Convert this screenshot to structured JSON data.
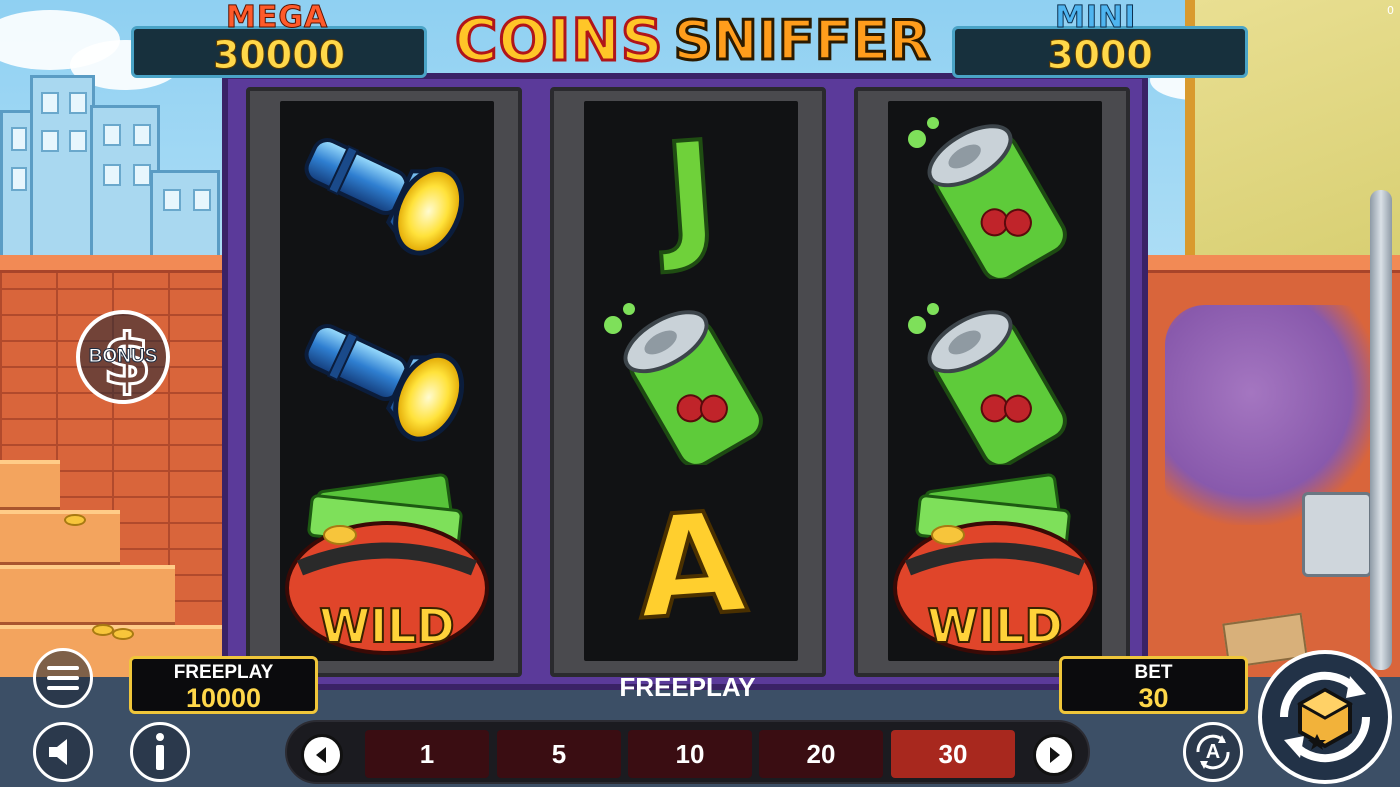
{
  "game": {
    "logo_part1": "COINS",
    "logo_part2": "SNIFFER",
    "corner_counter": "0"
  },
  "jackpots": {
    "mega": {
      "label": "MEGA",
      "value": "30000",
      "label_color": "#ff5a2a"
    },
    "mini": {
      "label": "MINI",
      "value": "3000",
      "label_color": "#4fb5f0"
    }
  },
  "reels": [
    [
      "flashlight",
      "flashlight",
      "wild"
    ],
    [
      "letter-j",
      "soda-can",
      "letter-a"
    ],
    [
      "soda-can",
      "soda-can",
      "wild"
    ]
  ],
  "symbol_text": {
    "letter_j": "J",
    "letter_a": "A",
    "wild": "WILD"
  },
  "bonus_button": {
    "label": "BONUS",
    "icon": "dollar-sign-icon"
  },
  "freeplay_box": {
    "label": "FREEPLAY",
    "value": "10000"
  },
  "bet_box": {
    "label": "BET",
    "value": "30"
  },
  "status": {
    "text": "FREEPLAY"
  },
  "bet_options": [
    "1",
    "5",
    "10",
    "20",
    "30"
  ],
  "bet_selected": "30",
  "controls": {
    "menu_icon": "menu-icon",
    "sound_icon": "speaker-icon",
    "info_icon": "info-icon",
    "auto_label": "A",
    "spin_icon": "spin-icon"
  },
  "colors": {
    "frame_purple": "#5b3a9a",
    "accent_gold": "#ffd84a",
    "active_bet": "#a8281e"
  }
}
